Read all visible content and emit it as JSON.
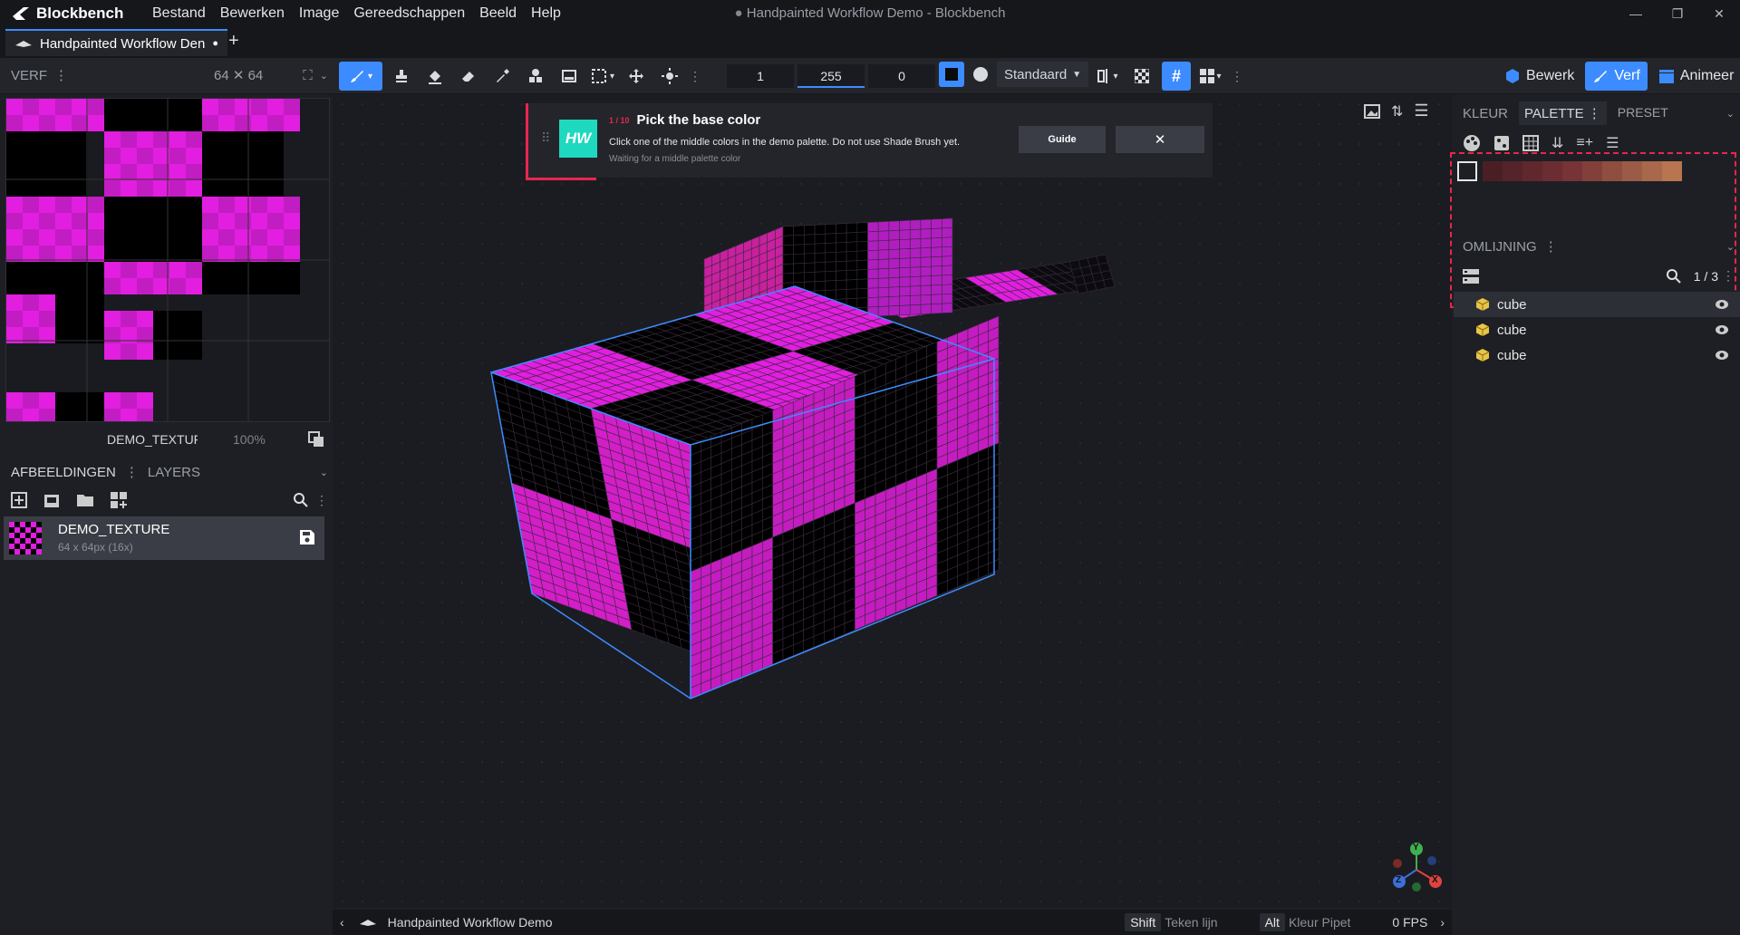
{
  "app": {
    "name": "Blockbench",
    "window_title": "Handpainted Workflow Demo - Blockbench"
  },
  "menu": [
    "Bestand",
    "Bewerken",
    "Image",
    "Gereedschappen",
    "Beeld",
    "Help"
  ],
  "tab": {
    "label": "Handpainted Workflow Den",
    "add": "+"
  },
  "toolbar": {
    "brush_size": "1",
    "opacity": "255",
    "softness": "0",
    "blend_mode": "Standaard",
    "modes": {
      "edit": "Bewerk",
      "paint": "Verf",
      "animate": "Animeer"
    }
  },
  "left": {
    "paint_header": "VERF",
    "texture_size": "64 ✕ 64",
    "texture_name": "DEMO_TEXTUF",
    "zoom": "100%",
    "tabs": [
      "AFBEELDINGEN",
      "LAYERS"
    ],
    "image": {
      "name": "DEMO_TEXTURE",
      "meta": "64 x 64px (16x)"
    }
  },
  "tutorial": {
    "logo": "HW",
    "step": "1 / 10",
    "title": "Pick the base color",
    "text": "Click one of the middle colors in the demo palette. Do not use Shade Brush yet.",
    "status": "Waiting for a middle palette color",
    "guide_label": "Guide",
    "close_label": "✕"
  },
  "right": {
    "tabs": [
      "KLEUR",
      "PALETTE",
      "PRESET LIBRARY"
    ],
    "palette_colors": [
      "#4a1f24",
      "#55232a",
      "#60282d",
      "#6b2d31",
      "#773335",
      "#83403a",
      "#8f4e40",
      "#9b5b46",
      "#a8684b",
      "#b87550"
    ],
    "outliner_header": "OMLIJNING",
    "outliner_count": "1 / 3",
    "cubes": [
      "cube",
      "cube",
      "cube"
    ]
  },
  "status": {
    "project": "Handpainted Workflow Demo",
    "shift_key": "Shift",
    "shift_label": "Teken lijn",
    "alt_key": "Alt",
    "alt_label": "Kleur Pipet",
    "fps": "0 FPS"
  },
  "gizmo": {
    "y": "Y",
    "x": "X",
    "z": "Z"
  },
  "colors": {
    "accent": "#3c8cff",
    "magenta": "#e21ee0",
    "tutorial_accent": "#e8264d",
    "tutorial_logo": "#1fd8c0"
  }
}
